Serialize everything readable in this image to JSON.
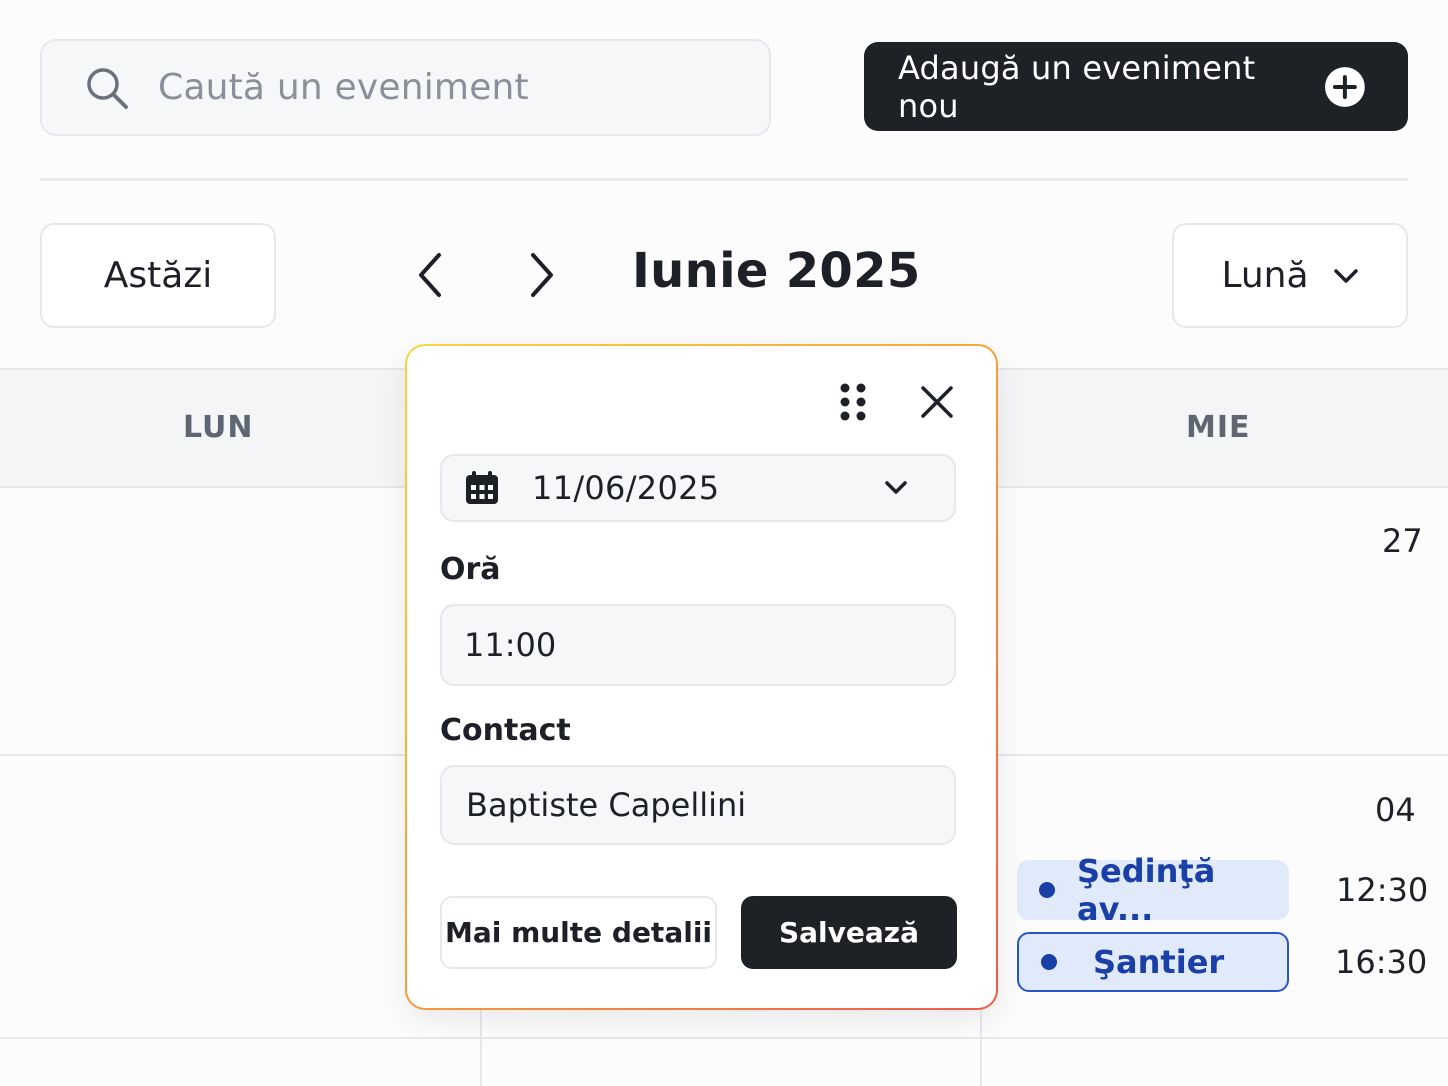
{
  "search": {
    "placeholder": "Caută un eveniment",
    "icon": "search-icon"
  },
  "toolbar": {
    "add_label": "Adaugă un eveniment nou",
    "add_icon": "plus-circle-icon"
  },
  "nav": {
    "today_label": "Astăzi",
    "prev_icon": "chevron-left-icon",
    "next_icon": "chevron-right-icon",
    "month_title": "Iunie 2025",
    "view_label": "Lună",
    "view_icon": "chevron-down-icon"
  },
  "calendar": {
    "day_headers": [
      "LUN",
      "MIE"
    ],
    "dates": [
      "27",
      "04"
    ],
    "events": [
      {
        "title": "Şedinţă av...",
        "time": "12:30",
        "style": "filled"
      },
      {
        "title": "Şantier",
        "time": "16:30",
        "style": "outlined"
      }
    ],
    "accent_color": "#1a3fa6"
  },
  "popover": {
    "grip_icon": "drag-handle-icon",
    "close_icon": "close-icon",
    "date_value": "11/06/2025",
    "date_icon": "calendar-icon",
    "time_label": "Oră",
    "time_value": "11:00",
    "contact_label": "Contact",
    "contact_value": "Baptiste Capellini",
    "more_label": "Mai multe detalii",
    "save_label": "Salvează"
  },
  "colors": {
    "primary_dark": "#1e2125",
    "border_gradient": [
      "#f7d640",
      "#ef5a4a"
    ]
  }
}
